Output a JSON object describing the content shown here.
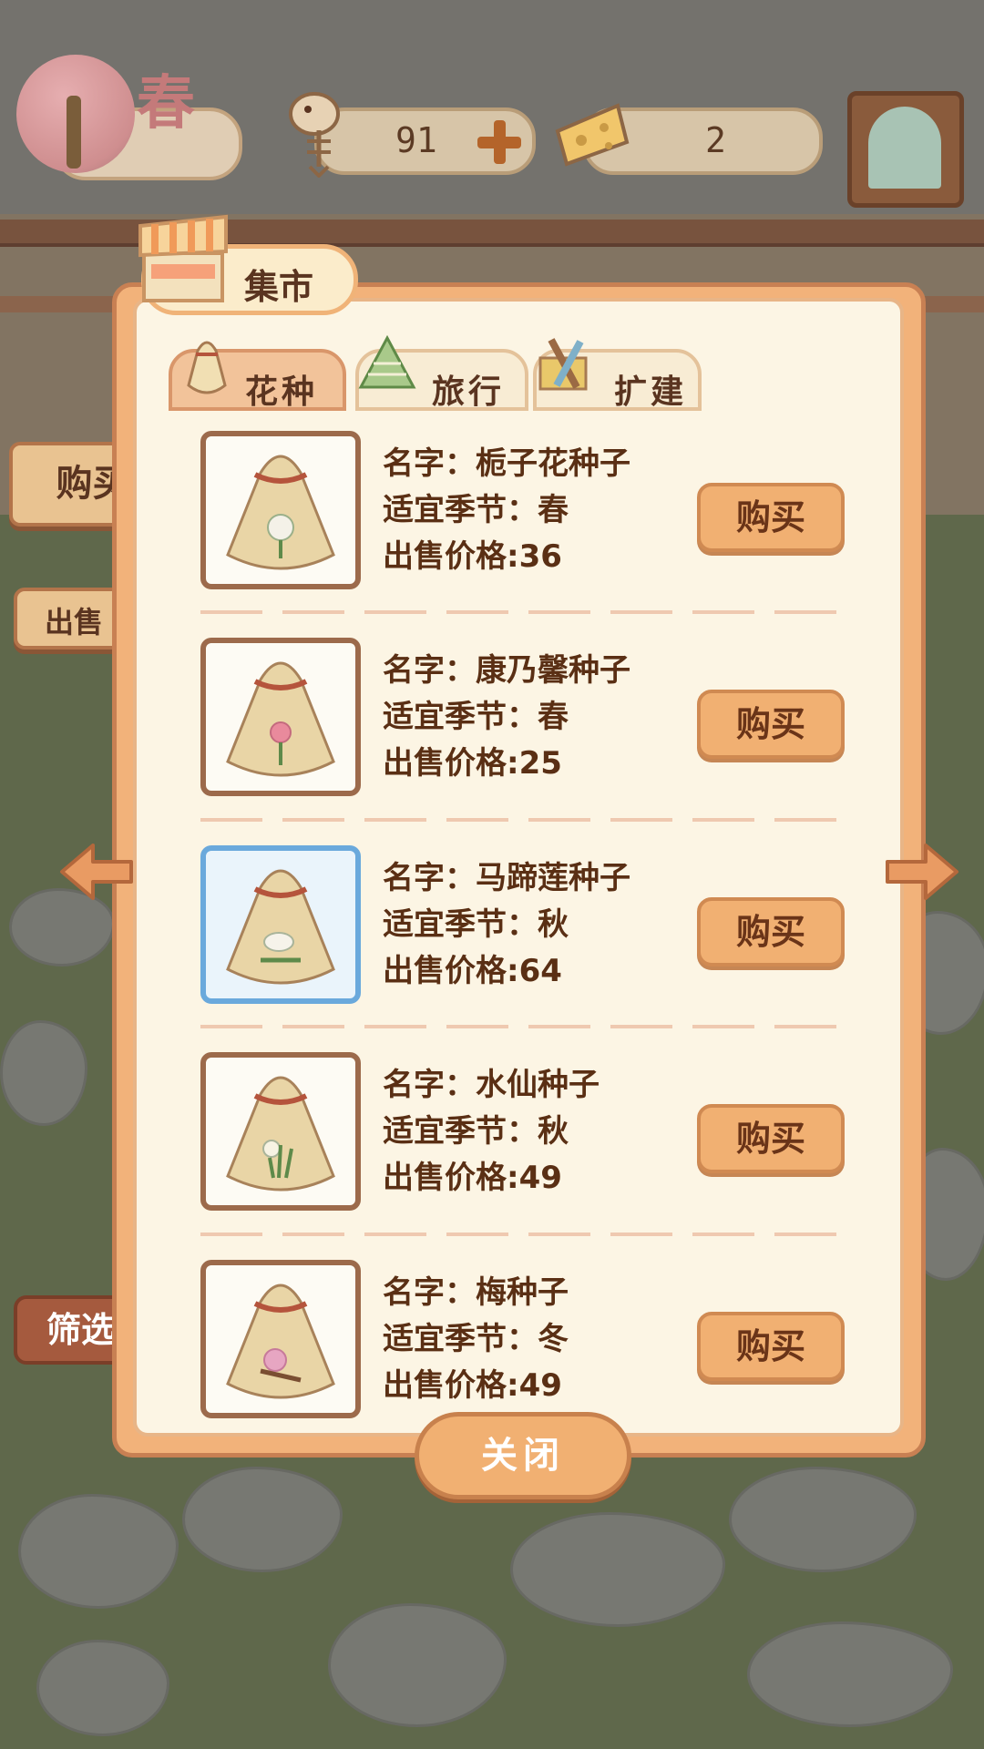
{
  "hud": {
    "season": "春",
    "fish_count": "91",
    "cheese_count": "2"
  },
  "side": {
    "buy": "购买",
    "sell": "出售",
    "filter": "筛选"
  },
  "market": {
    "title": "集市",
    "tabs": [
      "花种",
      "旅行",
      "扩建"
    ],
    "items": [
      {
        "name": "名字：栀子花种子",
        "season": "适宜季节：春",
        "price": "出售价格:36",
        "buy_label": "购买",
        "flower_color": "#f4f1e8"
      },
      {
        "name": "名字：康乃馨种子",
        "season": "适宜季节：春",
        "price": "出售价格:25",
        "buy_label": "购买",
        "flower_color": "#e98a9c"
      },
      {
        "name": "名字：马蹄莲种子",
        "season": "适宜季节：秋",
        "price": "出售价格:64",
        "buy_label": "购买",
        "flower_color": "#f6f3ea"
      },
      {
        "name": "名字：水仙种子",
        "season": "适宜季节：秋",
        "price": "出售价格:49",
        "buy_label": "购买",
        "flower_color": "#f7f3e3"
      },
      {
        "name": "名字：梅种子",
        "season": "适宜季节：冬",
        "price": "出售价格:49",
        "buy_label": "购买",
        "flower_color": "#e7a6c2"
      }
    ],
    "close_label": "关闭"
  },
  "colors": {
    "panel": "#f2b27a",
    "inner": "#fcf5e4",
    "text": "#5a2f14",
    "button": "#f1b072",
    "selected_border": "#6aa9dc"
  }
}
